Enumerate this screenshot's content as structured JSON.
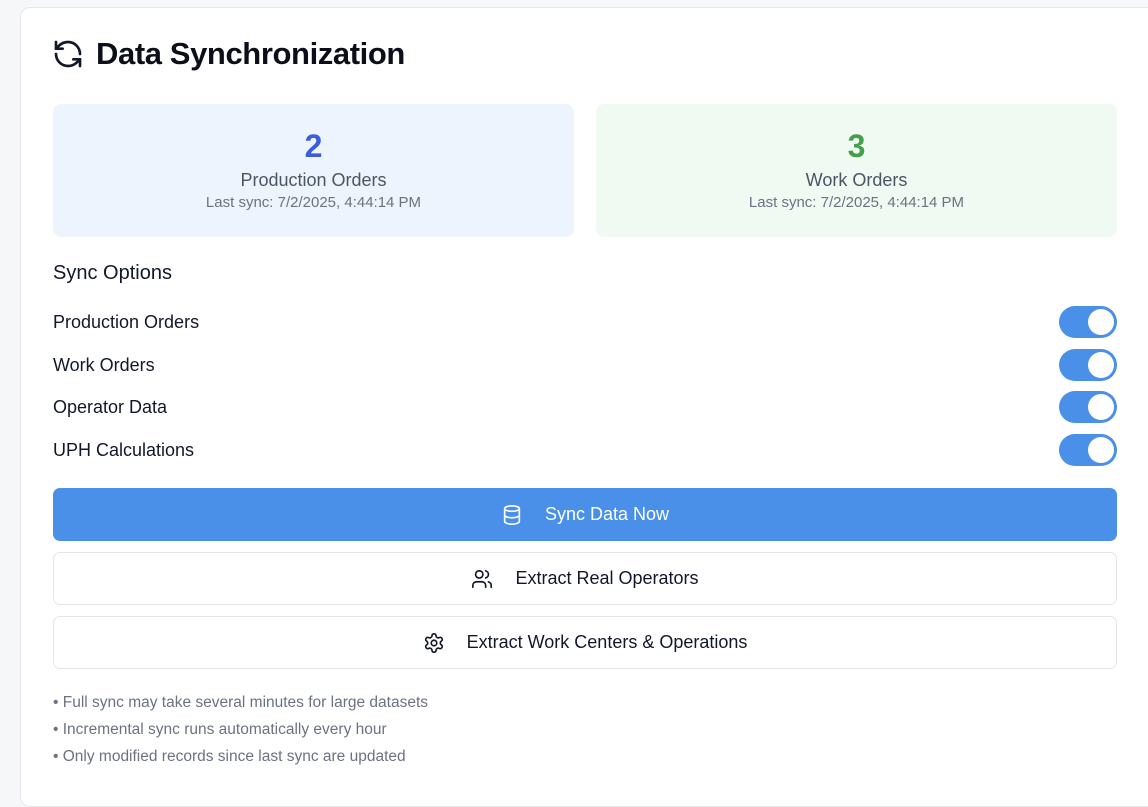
{
  "header": {
    "title": "Data Synchronization",
    "icon": "refresh-icon"
  },
  "stats": [
    {
      "count": "2",
      "label": "Production Orders",
      "last_sync": "Last sync: 7/2/2025, 4:44:14 PM",
      "color": "#3b5ddd"
    },
    {
      "count": "3",
      "label": "Work Orders",
      "last_sync": "Last sync: 7/2/2025, 4:44:14 PM",
      "color": "#43a04a"
    }
  ],
  "sync_options": {
    "title": "Sync Options",
    "items": [
      {
        "label": "Production Orders",
        "enabled": true
      },
      {
        "label": "Work Orders",
        "enabled": true
      },
      {
        "label": "Operator Data",
        "enabled": true
      },
      {
        "label": "UPH Calculations",
        "enabled": true
      }
    ]
  },
  "buttons": {
    "sync_now": {
      "label": "Sync Data Now",
      "icon": "database-icon"
    },
    "extract_operators": {
      "label": "Extract Real Operators",
      "icon": "users-icon"
    },
    "extract_work_centers": {
      "label": "Extract Work Centers & Operations",
      "icon": "gear-icon"
    }
  },
  "notes": [
    "• Full sync may take several minutes for large datasets",
    "• Incremental sync runs automatically every hour",
    "• Only modified records since last sync are updated"
  ],
  "colors": {
    "accent": "#4a90e8",
    "toggle_on": "#4a90e8"
  }
}
